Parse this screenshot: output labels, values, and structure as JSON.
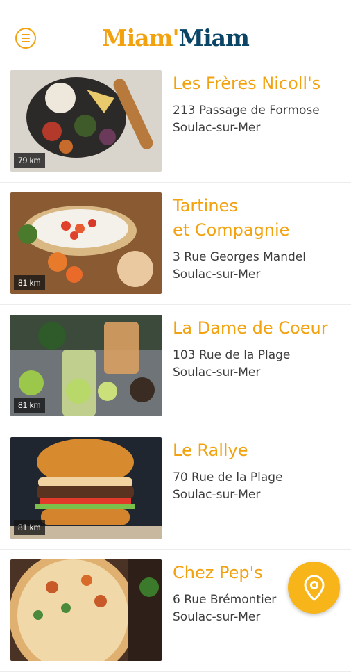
{
  "app": {
    "logo_part1": "Miam'",
    "logo_part2": "Miam",
    "accent_color": "#f2a20f",
    "brand_dark": "#0b4566"
  },
  "header": {
    "menu_icon": "menu-icon"
  },
  "restaurants": [
    {
      "name": "Les Frères Nicoll's",
      "address": "213 Passage de Formose\nSoulac-sur-Mer",
      "distance": "79 km"
    },
    {
      "name": "Tartines\net Compagnie",
      "address": "3 Rue Georges Mandel\nSoulac-sur-Mer",
      "distance": "81 km"
    },
    {
      "name": "La Dame de Coeur",
      "address": "103 Rue de la Plage\nSoulac-sur-Mer",
      "distance": "81 km"
    },
    {
      "name": "Le Rallye",
      "address": "70 Rue de la Plage\nSoulac-sur-Mer",
      "distance": "81 km"
    },
    {
      "name": "Chez Pep's",
      "address": "6 Rue Brémontier\nSoulac-sur-Mer",
      "distance": ""
    }
  ],
  "fab": {
    "icon": "map-pin-icon"
  }
}
